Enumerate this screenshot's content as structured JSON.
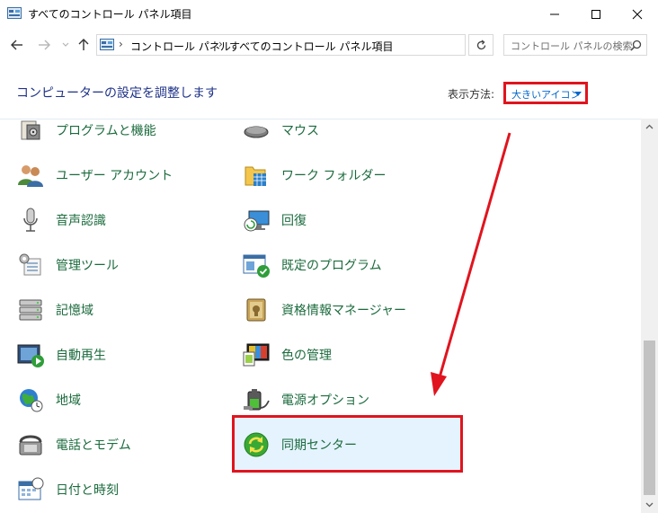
{
  "window": {
    "title": "すべてのコントロール パネル項目",
    "icon": "control-panel-icon"
  },
  "address": {
    "crumbs": [
      "コントロール パネル",
      "すべてのコントロール パネル項目"
    ],
    "search_placeholder": "コントロール パネルの検索"
  },
  "header": {
    "heading": "コンピューターの設定を調整します",
    "view_label": "表示方法:",
    "view_value": "大きいアイコン"
  },
  "items_left": [
    {
      "label": "プログラムと機能",
      "icon": "programs-features-icon"
    },
    {
      "label": "ユーザー アカウント",
      "icon": "user-accounts-icon"
    },
    {
      "label": "音声認識",
      "icon": "microphone-icon"
    },
    {
      "label": "管理ツール",
      "icon": "admin-tools-icon"
    },
    {
      "label": "記憶域",
      "icon": "storage-spaces-icon"
    },
    {
      "label": "自動再生",
      "icon": "autoplay-icon"
    },
    {
      "label": "地域",
      "icon": "region-globe-icon"
    },
    {
      "label": "電話とモデム",
      "icon": "phone-modem-icon"
    },
    {
      "label": "日付と時刻",
      "icon": "date-time-icon"
    }
  ],
  "items_right": [
    {
      "label": "マウス",
      "icon": "mouse-icon"
    },
    {
      "label": "ワーク フォルダー",
      "icon": "work-folders-icon"
    },
    {
      "label": "回復",
      "icon": "recovery-icon"
    },
    {
      "label": "既定のプログラム",
      "icon": "default-programs-icon"
    },
    {
      "label": "資格情報マネージャー",
      "icon": "credential-manager-icon"
    },
    {
      "label": "色の管理",
      "icon": "color-management-icon"
    },
    {
      "label": "電源オプション",
      "icon": "power-options-icon"
    },
    {
      "label": "同期センター",
      "icon": "sync-center-icon"
    }
  ],
  "colors": {
    "highlight": "#e0141e",
    "link_green": "#1b6b3d",
    "heading_blue": "#1e3287",
    "selection_bg": "#e5f3ff"
  }
}
